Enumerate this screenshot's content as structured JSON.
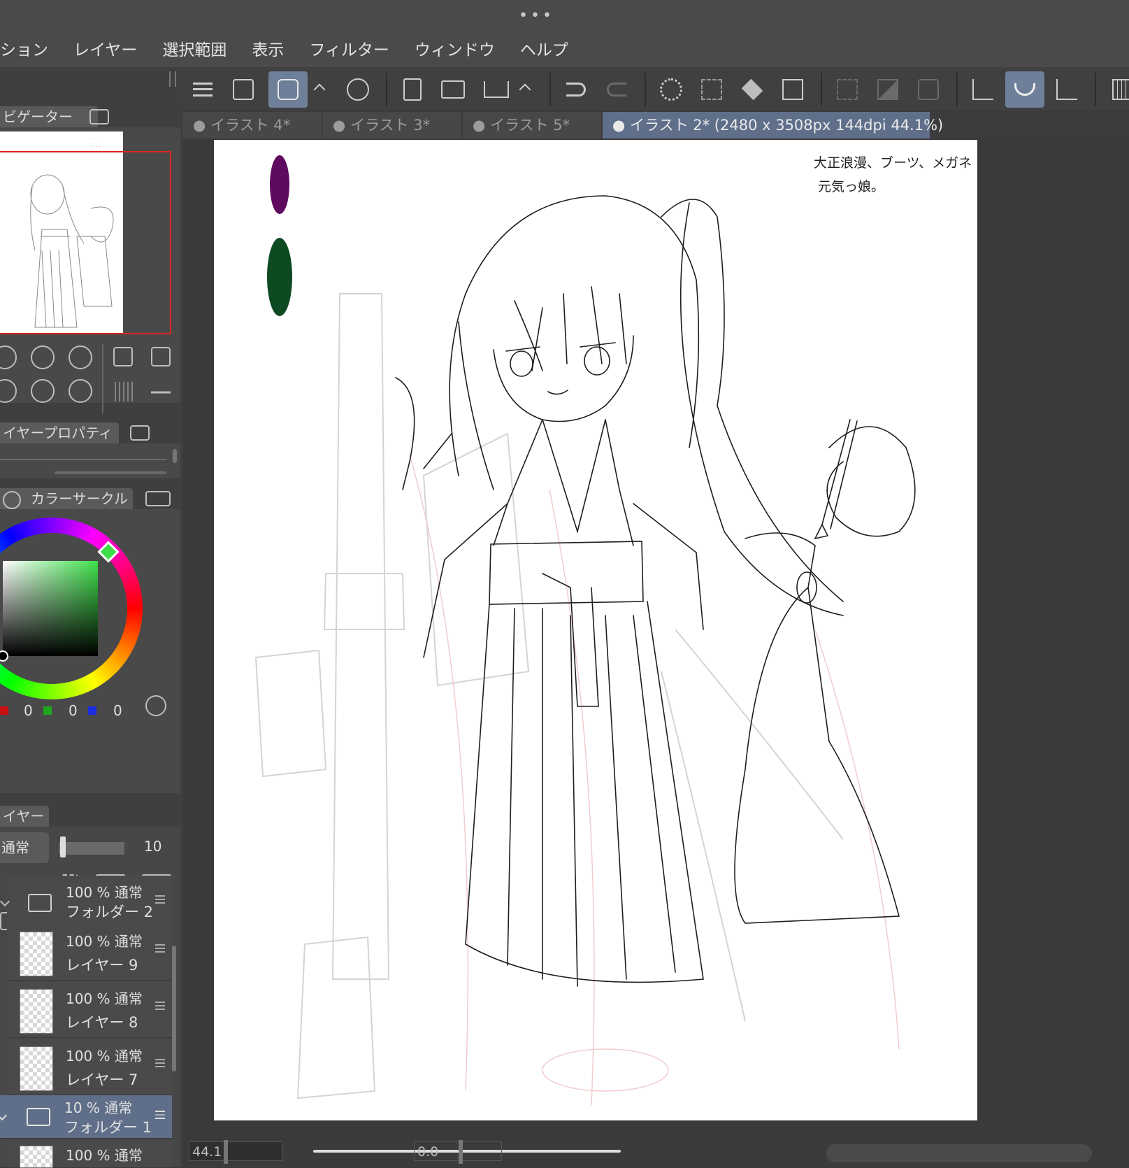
{
  "top_dots": "•••",
  "menu": [
    "ション",
    "レイヤー",
    "選択範囲",
    "表示",
    "フィルター",
    "ウィンドウ",
    "ヘルプ"
  ],
  "navigator": {
    "tab_label": "ビゲーター"
  },
  "layer_property": {
    "tab_label": "イヤープロパティ"
  },
  "color": {
    "tab_label": "カラーサークル",
    "r": "0",
    "g": "0",
    "b": "0",
    "accent": "#3ee04a"
  },
  "layer_panel": {
    "tab_label": "イヤー",
    "blend": "通常",
    "opacity": "10",
    "layers": [
      {
        "percent": "100 % 通常",
        "name": "フォルダー 2",
        "folder": true,
        "selected": false
      },
      {
        "percent": "100 % 通常",
        "name": "レイヤー 9",
        "folder": false,
        "selected": false
      },
      {
        "percent": "100 % 通常",
        "name": "レイヤー 8",
        "folder": false,
        "selected": false
      },
      {
        "percent": "100 % 通常",
        "name": "レイヤー 7",
        "folder": false,
        "selected": false
      },
      {
        "percent": "10 % 通常",
        "name": "フォルダー 1",
        "folder": true,
        "selected": true
      },
      {
        "percent": "100 % 通常",
        "name": "",
        "folder": false,
        "selected": false
      }
    ]
  },
  "doc_tabs": [
    {
      "label": "● イラスト 4*",
      "active": false
    },
    {
      "label": "● イラスト 3*",
      "active": false
    },
    {
      "label": "● イラスト 5*",
      "active": false
    },
    {
      "label": "● イラスト 2* (2480 x 3508px 144dpi 44.1%)",
      "active": true
    }
  ],
  "canvas": {
    "note_line1": "大正浪漫、ブーツ、メガネ",
    "note_line2": "元気っ娘。",
    "swatch_purple": "#5e0a5e",
    "swatch_green": "#0d4a22"
  },
  "status": {
    "zoom": "44.1",
    "angle": "0.0"
  }
}
